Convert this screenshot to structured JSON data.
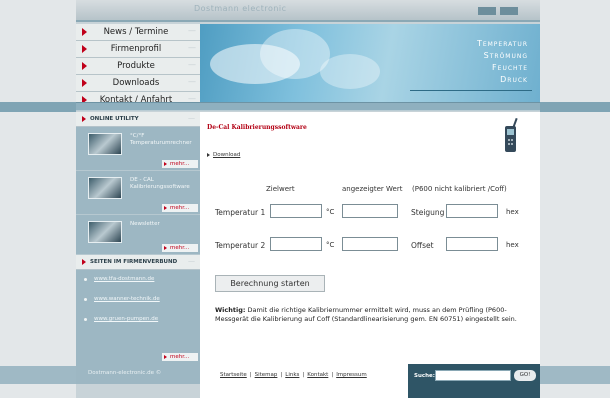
{
  "header": {
    "logo_text": "Dostmann electronic"
  },
  "topnav": {
    "items": [
      {
        "label": "News / Termine"
      },
      {
        "label": "Firmenprofil"
      },
      {
        "label": "Produkte"
      },
      {
        "label": "Downloads"
      },
      {
        "label": "Kontakt / Anfahrt"
      }
    ]
  },
  "banner": {
    "lines": [
      "Temperatur",
      "Strömung",
      "Feuchte",
      "Druck"
    ]
  },
  "sidebar": {
    "online_header": "ONLINE UTILITY",
    "blocks": [
      {
        "title": "°C/°F Temperaturumrechner",
        "more": "mehr..."
      },
      {
        "title": "DE - CAL Kalibrierungssoftware",
        "more": "mehr..."
      },
      {
        "title": "Newsletter",
        "more": "mehr..."
      }
    ],
    "partner_header": "SEITEN IM FIRMENVERBUND",
    "links": [
      "www.tfa-dostmann.de",
      "www.wanner-technik.de",
      "www.gruen-pumpen.de"
    ],
    "links_more": "mehr..."
  },
  "main": {
    "title": "De-Cal Kalibrierungssoftware",
    "download_label": "Download",
    "col_zielwert": "Zielwert",
    "col_angezeigt": "angezeigter Wert",
    "col_note": "(P600 nicht kalibriert /Coff)",
    "row1_label": "Temperatur 1",
    "row2_label": "Temperatur 2",
    "unit_c": "°C",
    "steigung_label": "Steigung",
    "offset_label": "Offset",
    "unit_hex": "hex",
    "fields": {
      "t1_ziel": "",
      "t1_angezeigt": "",
      "steigung": "",
      "t2_ziel": "",
      "t2_angezeigt": "",
      "offset": ""
    },
    "calc_button": "Berechnung starten",
    "note_bold": "Wichtig:",
    "note_text": " Damit die richtige Kalibriernummer ermittelt wird, muss an dem Prüfling (P600-Messgerät die Kalibrierung auf Coff (Standardlinearisierung gem. EN 60751) eingestellt sein."
  },
  "footer": {
    "copyright": "Dostmann-electronic.de ©",
    "links": [
      "Startseite",
      "Sitemap",
      "Links",
      "Kontakt",
      "Impressum"
    ],
    "separator": "|",
    "search_label": "Suche:",
    "search_value": "",
    "go_label": "GO!"
  },
  "colors": {
    "accent_red": "#c0001a",
    "sidebar_blue": "#9db7c3",
    "footer_dark": "#2f5566"
  }
}
